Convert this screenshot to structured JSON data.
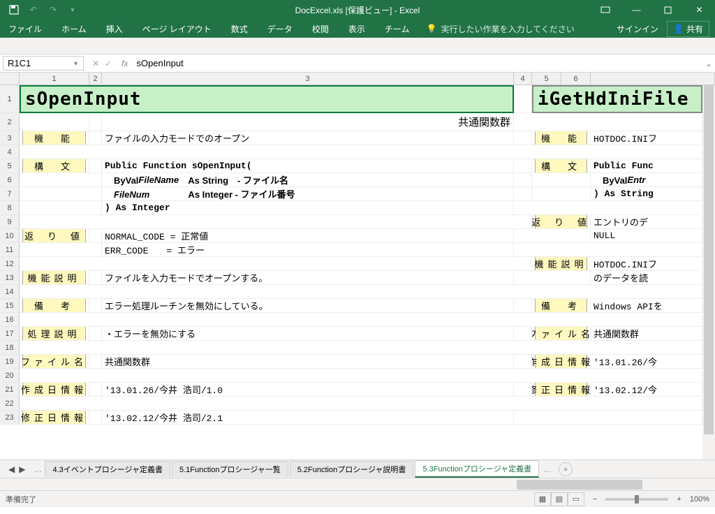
{
  "title": "DocExcel.xls [保護ビュー] - Excel",
  "ribbon": {
    "tabs": [
      "ファイル",
      "ホーム",
      "挿入",
      "ページ レイアウト",
      "数式",
      "データ",
      "校閲",
      "表示",
      "チーム"
    ],
    "tell_me": "実行したい作業を入力してください",
    "sign_in": "サインイン",
    "share": "共有"
  },
  "formula_bar": {
    "name_box": "R1C1",
    "formula": "sOpenInput"
  },
  "columns": [
    "1",
    "2",
    "3",
    "4",
    "5",
    "6"
  ],
  "left": {
    "title": "sOpenInput",
    "subtitle": "共通関数群",
    "sections": {
      "kinou": {
        "label": "機　能",
        "text": "ファイルの入力モードでのオープン"
      },
      "koubun": {
        "label": "構　文",
        "lines": [
          "Public Function sOpenInput(",
          "　ByVal FileName　As String　- ファイル名",
          "　FileNum　　　　 As Integer - ファイル番号",
          ") As Integer"
        ]
      },
      "kaeri": {
        "label": "返 り 値",
        "lines": [
          "NORMAL_CODE = 正常値",
          "ERR_CODE　　= エラー"
        ]
      },
      "kinou_ex": {
        "label": "機能説明",
        "text": "ファイルを入力モードでオープンする。"
      },
      "bikou": {
        "label": "備　考",
        "text": "エラー処理ルーチンを無効にしている。"
      },
      "shori": {
        "label": "処理説明",
        "text": "・エラーを無効にする"
      },
      "file": {
        "label": "ファイル名",
        "text": "共通関数群"
      },
      "created": {
        "label": "作成日情報",
        "text": "'13.01.26/今井 浩司/1.0"
      },
      "modified": {
        "label": "修正日情報",
        "text": "'13.02.12/今井 浩司/2.1"
      }
    }
  },
  "right": {
    "title": "iGetHdIniFile",
    "sections": {
      "kinou": {
        "label": "機　能",
        "text": "HOTDOC.INIフ"
      },
      "koubun": {
        "label": "構　文",
        "lines": [
          "Public Func",
          "　ByVal Entr",
          ") As String"
        ]
      },
      "kaeri": {
        "label": "返 り 値",
        "lines": [
          "エントリのデ",
          "NULL"
        ]
      },
      "kinou_ex": {
        "label": "機能説明",
        "lines": [
          "HOTDOC.INIフ",
          "のデータを読"
        ]
      },
      "bikou": {
        "label": "備　考",
        "text": "Windows APIを"
      },
      "file": {
        "label": "ファイル名",
        "text": "共通関数群"
      },
      "created": {
        "label": "作成日情報",
        "text": "'13.01.26/今"
      },
      "modified": {
        "label": "修正日情報",
        "text": "'13.02.12/今"
      }
    }
  },
  "sheet_tabs": [
    "4.3イベントプロシージャ定義書",
    "5.1Functionプロシージャ一覧",
    "5.2Functionプロシージャ説明書",
    "5.3Functionプロシージャ定義書"
  ],
  "active_tab_index": 3,
  "status": {
    "ready": "準備完了",
    "zoom": "100%"
  }
}
